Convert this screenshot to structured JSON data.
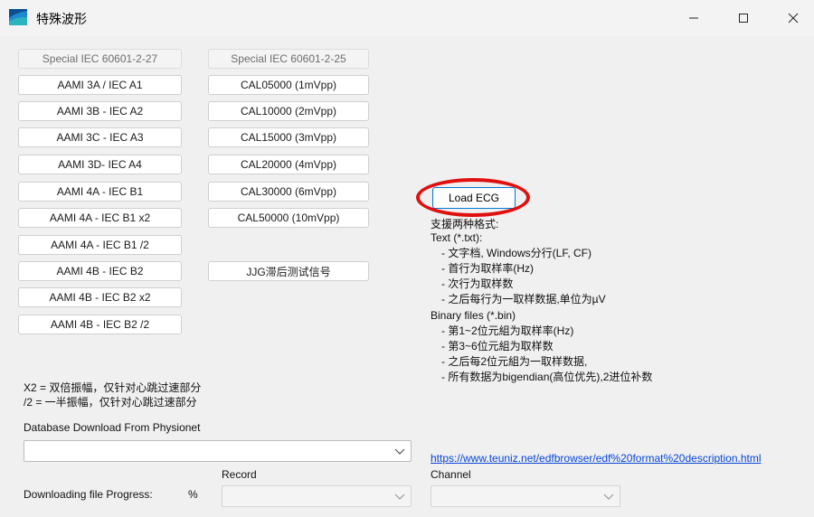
{
  "window": {
    "title": "特殊波形",
    "controls": {
      "minimize": "—",
      "maximize": "☐",
      "close": "✕"
    },
    "icon": "app-logo-icon"
  },
  "column1": [
    {
      "label": "Special IEC 60601-2-27",
      "enabled": false
    },
    {
      "label": "AAMI 3A / IEC A1",
      "enabled": true
    },
    {
      "label": "AAMI 3B - IEC A2",
      "enabled": true
    },
    {
      "label": "AAMI 3C - IEC A3",
      "enabled": true
    },
    {
      "label": "AAMI 3D- IEC A4",
      "enabled": true
    },
    {
      "label": "AAMI 4A - IEC B1",
      "enabled": true
    },
    {
      "label": "AAMI 4A - IEC B1 x2",
      "enabled": true
    },
    {
      "label": "AAMI 4A - IEC B1 /2",
      "enabled": true
    },
    {
      "label": "AAMI 4B - IEC B2",
      "enabled": true
    },
    {
      "label": "AAMI 4B - IEC B2 x2",
      "enabled": true
    },
    {
      "label": "AAMI 4B - IEC B2 /2",
      "enabled": true
    }
  ],
  "column2": [
    {
      "label": "Special IEC 60601-2-25",
      "enabled": false
    },
    {
      "label": "CAL05000 (1mVpp)",
      "enabled": true
    },
    {
      "label": "CAL10000 (2mVpp)",
      "enabled": true
    },
    {
      "label": "CAL15000 (3mVpp)",
      "enabled": true
    },
    {
      "label": "CAL20000 (4mVpp)",
      "enabled": true
    },
    {
      "label": "CAL30000 (6mVpp)",
      "enabled": true
    },
    {
      "label": "CAL50000 (10mVpp)",
      "enabled": true
    },
    {
      "label": "JJG滞后测试信号",
      "enabled": true
    }
  ],
  "load": {
    "label": "Load ECG"
  },
  "info": {
    "lines": [
      "支援两种格式:",
      "Text (*.txt):",
      "- 文字档, Windows分行(LF, CF)",
      "- 首行为取样率(Hz)",
      "- 次行为取样数",
      "- 之后每行为一取样数据,单位为µV",
      "Binary files (*.bin)",
      "- 第1~2位元組为取样率(Hz)",
      "- 第3~6位元組为取样数",
      "- 之后每2位元組为一取样数据,",
      "- 所有数据为bigendian(高位优先),2进位补数"
    ]
  },
  "notes": {
    "x2": "X2 = 双倍振幅，仅针对心跳过速部分",
    "half": "/2 = 一半振幅，仅针对心跳过速部分"
  },
  "database": {
    "label": "Database Download From Physionet",
    "value": "",
    "record_label": "Record",
    "progress_label": "Downloading file Progress:",
    "progress_unit": "%",
    "record_value": ""
  },
  "channel": {
    "label": "Channel",
    "value": ""
  },
  "link": {
    "text": "https://www.teuniz.net/edfbrowser/edf%20format%20description.html"
  },
  "colors": {
    "highlight": "#e01010",
    "link": "#0645d8",
    "focus": "#0078d4"
  }
}
